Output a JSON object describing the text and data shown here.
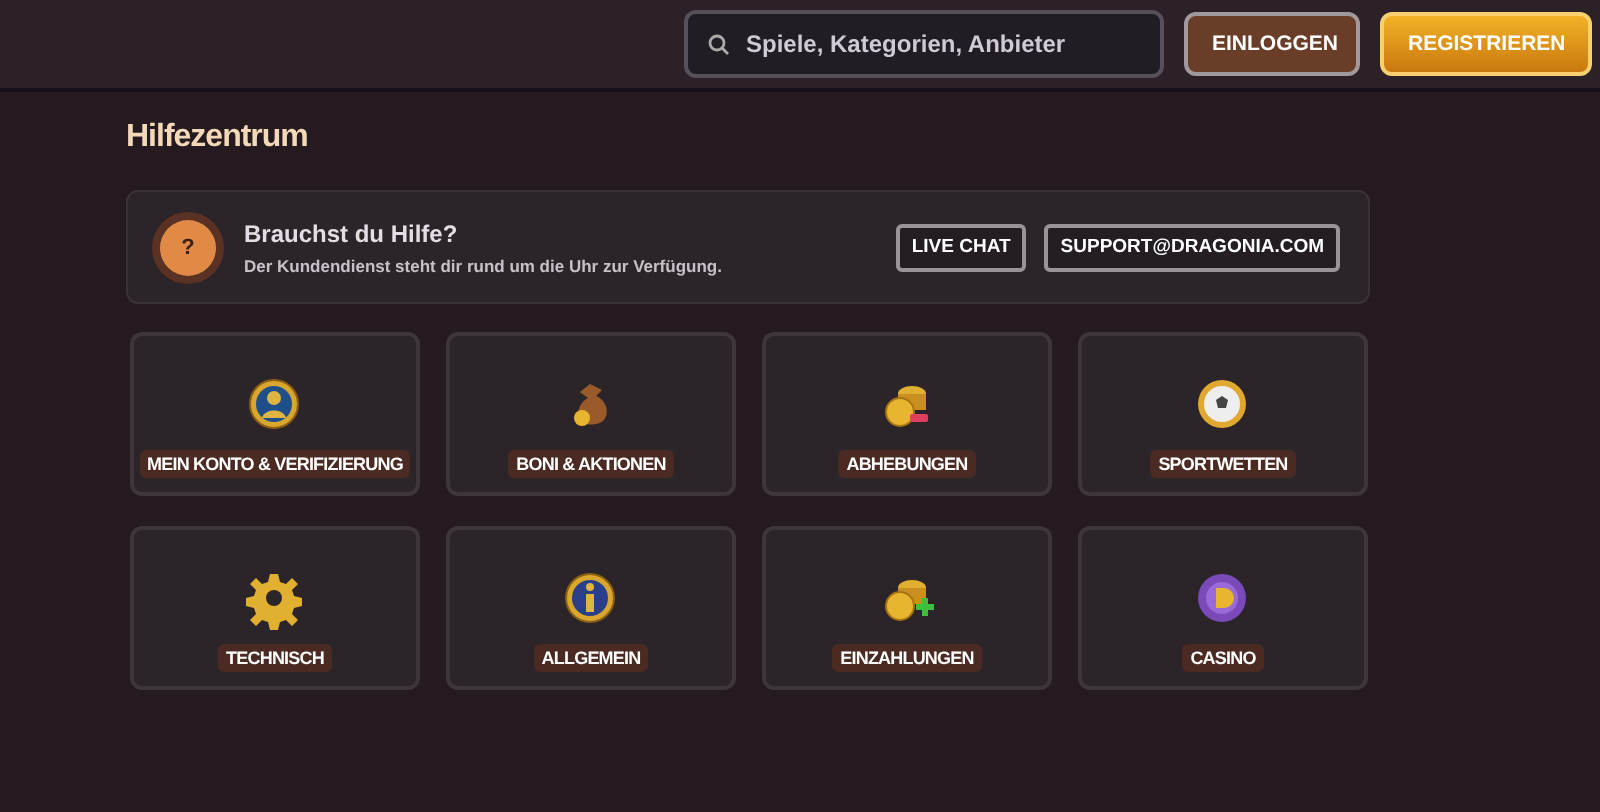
{
  "header": {
    "search": {
      "placeholder": "Spiele, Kategorien, Anbieter"
    },
    "buttons": [
      {
        "label": "EINLOGGEN",
        "kind": "login"
      },
      {
        "label": "REGISTRIEREN",
        "kind": "register"
      }
    ]
  },
  "title": "Hilfezentrum",
  "help": {
    "icon": "?",
    "heading": "Brauchst du Hilfe?",
    "text": "Der Kundendienst steht dir rund um die Uhr zur Verfügung.",
    "actions": [
      "LIVE CHAT",
      "SUPPORT@DRAGONIA.COM"
    ]
  },
  "categories": [
    {
      "label": "MEIN KONTO & VERIFIZIERUNG",
      "kind": "user"
    },
    {
      "label": "BONI & AKTIONEN",
      "kind": "bag"
    },
    {
      "label": "ABHEBUNGEN",
      "kind": "withdraw"
    },
    {
      "label": "SPORTWETTEN",
      "kind": "ball"
    },
    {
      "label": "TECHNISCH",
      "kind": "gear"
    },
    {
      "label": "ALLGEMEIN",
      "kind": "info"
    },
    {
      "label": "EINZAHLUNGEN",
      "kind": "deposit"
    },
    {
      "label": "CASINO",
      "kind": "chip"
    }
  ]
}
